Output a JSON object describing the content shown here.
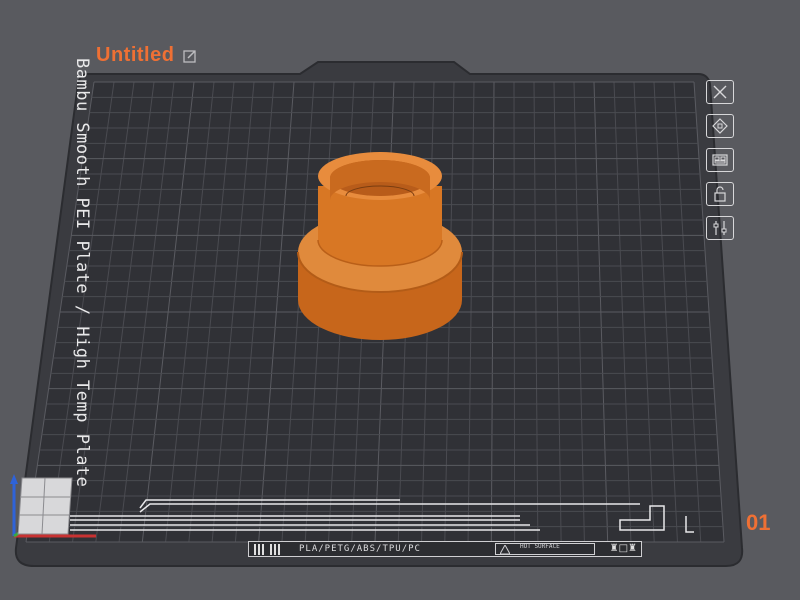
{
  "project": {
    "title": "Untitled"
  },
  "plate": {
    "name": "Bambu Smooth PEI Plate / High Temp Plate",
    "number": "01",
    "filaments_label": "PLA/PETG/ABS/TPU/PC",
    "hot_surface_label": "HOT SURFACE",
    "strip_icons": "♜□♜"
  },
  "toolbar": {
    "items": [
      {
        "name": "delete-plate",
        "icon": "close-icon"
      },
      {
        "name": "arrange-plate",
        "icon": "arrange-icon"
      },
      {
        "name": "orient-plate",
        "icon": "orient-icon"
      },
      {
        "name": "lock-plate",
        "icon": "lock-icon"
      },
      {
        "name": "plate-settings",
        "icon": "sliders-icon"
      }
    ]
  },
  "colors": {
    "background": "#595a5f",
    "plate": "#2f3035",
    "grid": "#4c4d53",
    "accent": "#ef7034",
    "model": "#d7711f"
  }
}
